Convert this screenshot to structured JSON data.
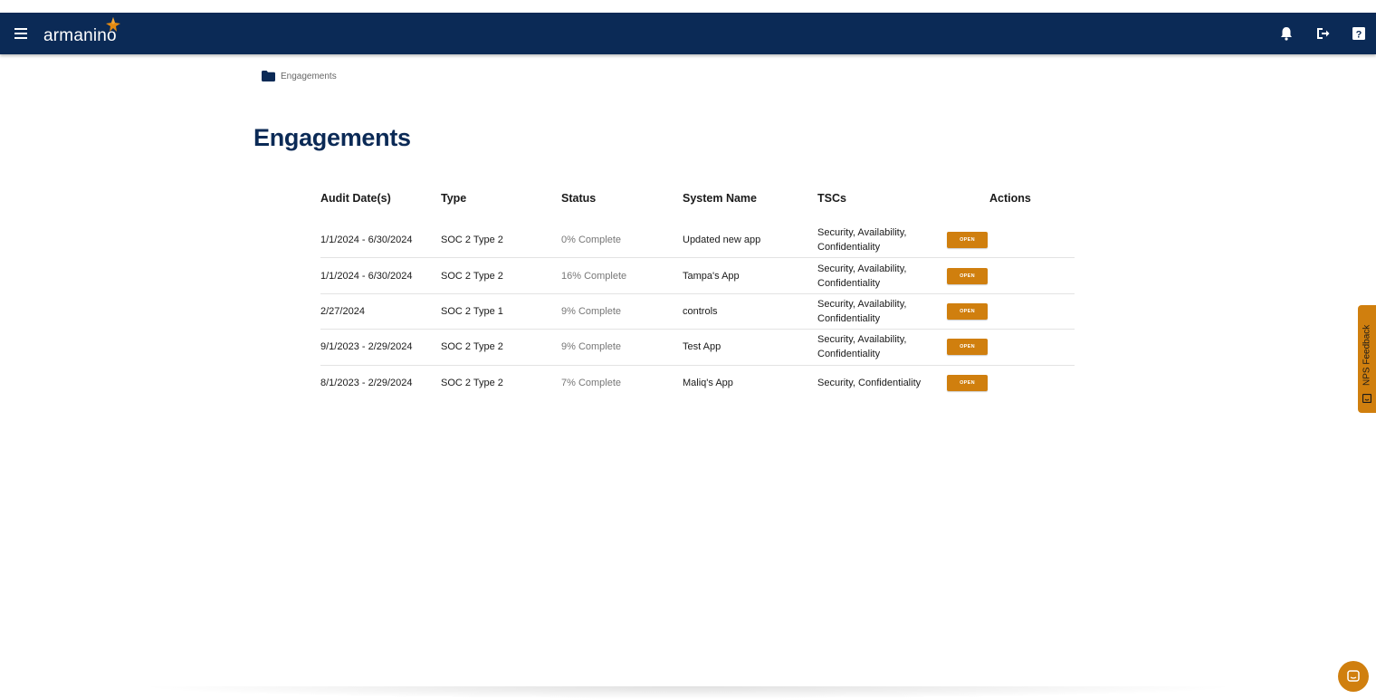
{
  "header": {
    "logo_text": "armanino",
    "icons": [
      "menu-icon",
      "bell-icon",
      "logout-icon",
      "help-icon"
    ],
    "help_glyph": "?"
  },
  "breadcrumb": {
    "label": "Engagements"
  },
  "page": {
    "title": "Engagements"
  },
  "table": {
    "columns": [
      "Audit Date(s)",
      "Type",
      "Status",
      "System Name",
      "TSCs",
      "Actions"
    ],
    "rows": [
      {
        "date": "1/1/2024 - 6/30/2024",
        "type": "SOC 2 Type 2",
        "status": "0% Complete",
        "system": "Updated new app",
        "tscs": "Security, Availability, Confidentiality",
        "action": "OPEN"
      },
      {
        "date": "1/1/2024 - 6/30/2024",
        "type": "SOC 2 Type 2",
        "status": "16% Complete",
        "system": "Tampa's App",
        "tscs": "Security, Availability, Confidentiality",
        "action": "OPEN"
      },
      {
        "date": "2/27/2024",
        "type": "SOC 2 Type 1",
        "status": "9% Complete",
        "system": "controls",
        "tscs": "Security, Availability, Confidentiality",
        "action": "OPEN"
      },
      {
        "date": "9/1/2023 - 2/29/2024",
        "type": "SOC 2 Type 2",
        "status": "9% Complete",
        "system": "Test App",
        "tscs": "Security, Availability, Confidentiality",
        "action": "OPEN"
      },
      {
        "date": "8/1/2023 - 2/29/2024",
        "type": "SOC 2 Type 2",
        "status": "7% Complete",
        "system": "Maliq's App",
        "tscs": "Security, Confidentiality",
        "action": "OPEN"
      }
    ]
  },
  "feedback": {
    "label": "NPS Feedback"
  },
  "colors": {
    "navy": "#0b2a56",
    "accent": "#d07f0e"
  }
}
